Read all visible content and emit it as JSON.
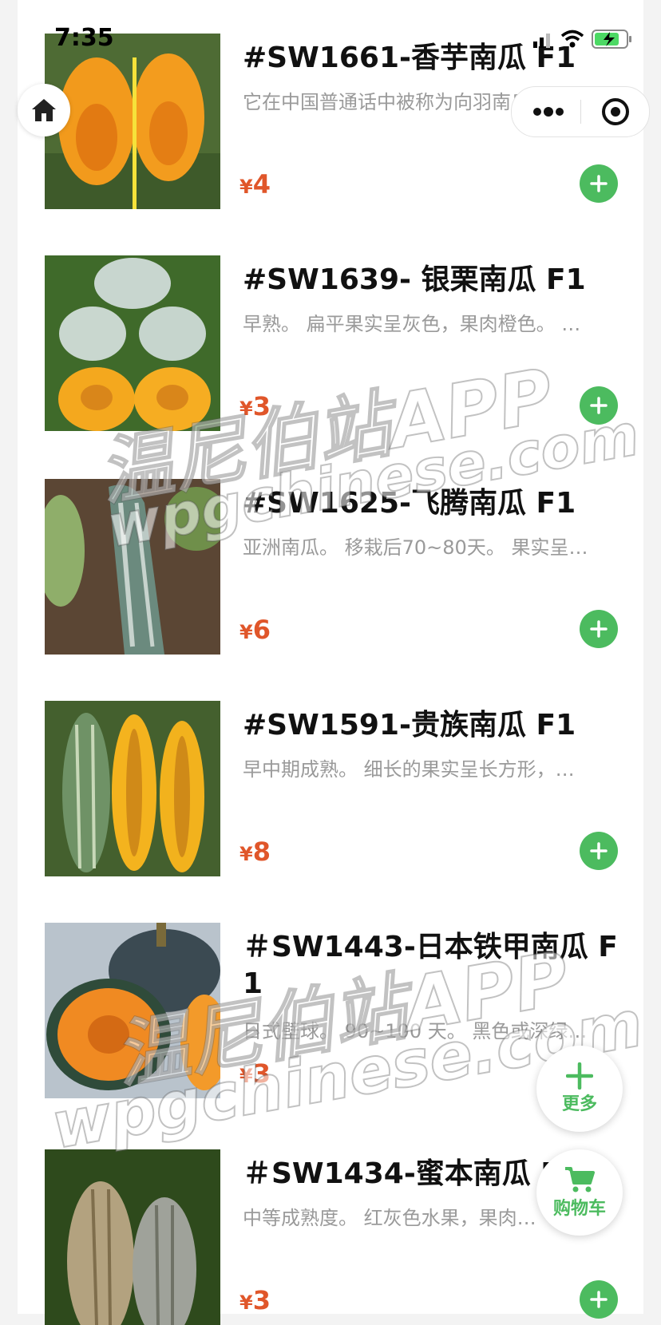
{
  "status_bar": {
    "time": "7:35"
  },
  "watermark": {
    "line1": "温尼伯站APP",
    "line2": "wpgchinese.com"
  },
  "products": [
    {
      "title": "#SW1661-香芋南瓜 F1",
      "desc": "它在中国普通话中被称为向羽南瓜。…",
      "currency": "¥",
      "price": "4"
    },
    {
      "title": "#SW1639- 银栗南瓜 F1",
      "desc": "早熟。 扁平果实呈灰色，果肉橙色。 …",
      "currency": "¥",
      "price": "3"
    },
    {
      "title": "#SW1625-飞腾南瓜 F1",
      "desc": "亚洲南瓜。 移栽后70~80天。 果实呈…",
      "currency": "¥",
      "price": "6"
    },
    {
      "title": "#SW1591-贵族南瓜 F1",
      "desc": "早中期成熟。 细长的果实呈长方形，…",
      "currency": "¥",
      "price": "8"
    },
    {
      "title": "＃SW1443-日本铁甲南瓜 F1",
      "desc": "日式壁球。 90~100 天。 黑色或深绿…",
      "currency": "¥",
      "price": "3"
    },
    {
      "title": "＃SW1434-蜜本南瓜 F1",
      "desc": "中等成熟度。 红灰色水果，果肉…",
      "currency": "¥",
      "price": "3"
    }
  ],
  "fab": {
    "more_label": "更多",
    "cart_label": "购物车"
  },
  "colors": {
    "accent": "#4cbb5f",
    "price": "#e0562a"
  }
}
